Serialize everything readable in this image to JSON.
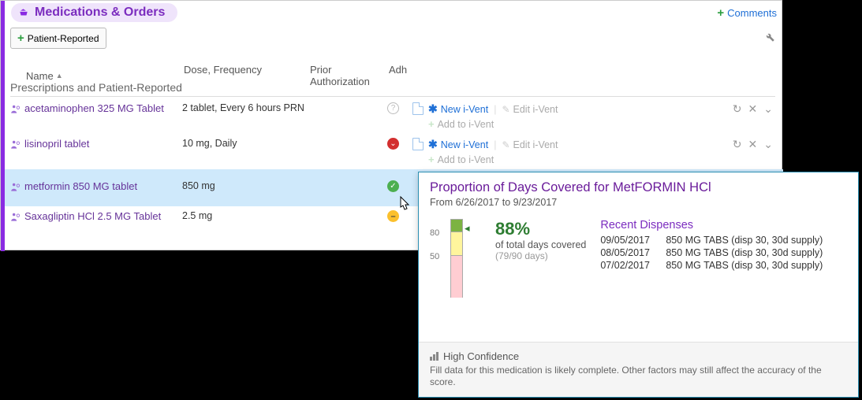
{
  "header": {
    "title": "Medications & Orders",
    "comments": "Comments"
  },
  "toolbar": {
    "patient_reported": "Patient-Reported"
  },
  "columns": {
    "name": "Name",
    "dose": "Dose, Frequency",
    "prior": "Prior Authorization",
    "adh": "Adh"
  },
  "section": {
    "title": "Prescriptions and Patient-Reported"
  },
  "actions": {
    "new_ivent": "New i-Vent",
    "edit_ivent": "Edit i-Vent",
    "add_ivent": "Add to i-Vent"
  },
  "rows": [
    {
      "name": "acetaminophen 325 MG Tablet",
      "dose": "2 tablet, Every 6 hours PRN",
      "adh": "question"
    },
    {
      "name": "lisinopril tablet",
      "dose": "10 mg, Daily",
      "adh": "red"
    },
    {
      "name": "metformin 850 MG tablet",
      "dose": "850 mg",
      "adh": "green",
      "highlight": true
    },
    {
      "name": "Saxagliptin HCl 2.5 MG Tablet",
      "dose": "2.5 mg",
      "adh": "yellow"
    }
  ],
  "tooltip": {
    "title": "Proportion of Days Covered for MetFORMIN HCl",
    "range": "From 6/26/2017 to 9/23/2017",
    "pct": "88%",
    "sub1": "of total days covered",
    "sub2": "(79/90 days)",
    "axis80": "80",
    "axis50": "50",
    "dispenses_title": "Recent Dispenses",
    "dispenses": [
      {
        "date": "09/05/2017",
        "text": "850 MG TABS (disp 30, 30d supply)"
      },
      {
        "date": "08/05/2017",
        "text": "850 MG TABS (disp 30, 30d supply)"
      },
      {
        "date": "07/02/2017",
        "text": "850 MG TABS (disp 30, 30d supply)"
      }
    ],
    "confidence_label": "High Confidence",
    "confidence_text": "Fill data for this medication is likely complete. Other factors may still affect the accuracy of the score."
  },
  "chart_data": {
    "type": "bar",
    "title": "Proportion of Days Covered",
    "thresholds": [
      50,
      80
    ],
    "value": 88,
    "ylim": [
      0,
      100
    ],
    "bands": [
      {
        "from": 80,
        "to": 100,
        "color": "#7cb342"
      },
      {
        "from": 50,
        "to": 80,
        "color": "#fff59d"
      },
      {
        "from": 0,
        "to": 50,
        "color": "#ffcdd2"
      }
    ]
  }
}
